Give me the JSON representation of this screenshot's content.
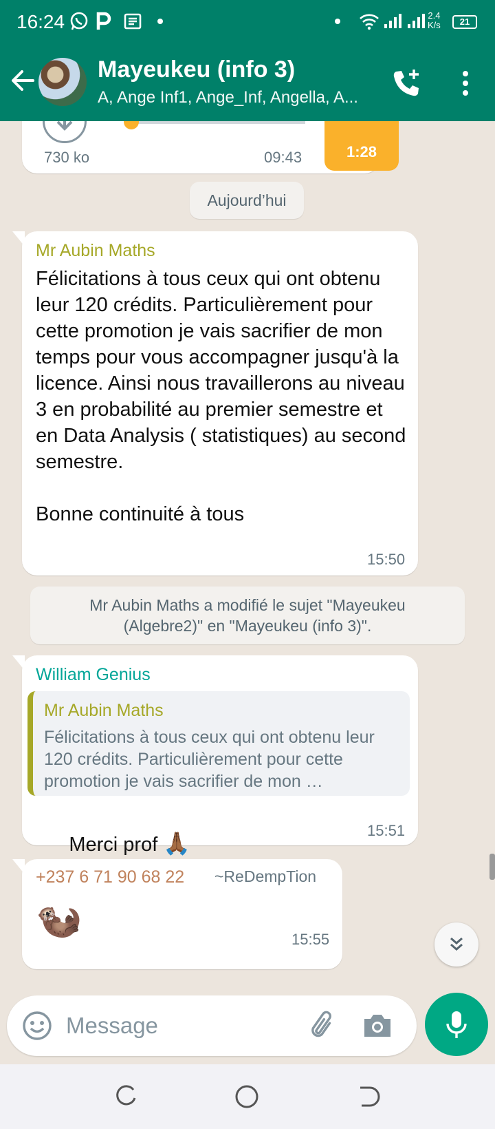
{
  "status_bar": {
    "time": "16:24",
    "speed_value": "2.4",
    "speed_unit": "K/s",
    "battery": "21"
  },
  "header": {
    "title": "Mayeukeu (info 3)",
    "subtitle": "A, Ange Inf1, Ange_Inf, Angella, A..."
  },
  "audio_message": {
    "size": "730 ko",
    "time": "09:43",
    "duration": "1:28",
    "progress": 0.0
  },
  "date_chip": "Aujourd’hui",
  "messages": [
    {
      "sender": "Mr Aubin Maths",
      "sender_color": "#a6a828",
      "text": "Félicitations à tous ceux qui ont obtenu leur 120 crédits. Particulièrement pour cette promotion je vais sacrifier de mon temps pour vous accompagner jusqu'à la licence. Ainsi nous travaillerons au niveau 3 en probabilité au premier semestre et en Data Analysis ( statistiques) au second semestre.\n\nBonne continuité à tous",
      "time": "15:50"
    },
    {
      "sender": "William Genius",
      "sender_color": "#02a698",
      "quote_sender": "Mr Aubin Maths",
      "quote_text": "Félicitations à tous ceux qui ont obtenu leur 120 crédits. Particulièrement pour cette promotion je vais sacrifier de mon …",
      "text": "Merci prof ",
      "emoji": "🙏🏾",
      "time": "15:51"
    },
    {
      "sender": "+237 6 71 90 68 22",
      "sender_color": "#c0825c",
      "push_name": "~ReDempTion",
      "emoji": "🦦",
      "time": "15:55"
    }
  ],
  "system_message": "Mr Aubin Maths a modifié le sujet \"Mayeukeu (Algebre2)\" en \"Mayeukeu (info 3)\".",
  "input": {
    "placeholder": "Message",
    "value": ""
  },
  "colors": {
    "header": "#008069",
    "accent": "#00a884",
    "chat_bg": "#ece5dd"
  },
  "icons": [
    "whatsapp-icon",
    "parking-icon",
    "news-icon",
    "wifi-icon",
    "signal-icon",
    "battery-icon",
    "back-arrow-icon",
    "add-call-icon",
    "more-vert-icon",
    "download-icon",
    "double-chevron-down-icon",
    "emoji-icon",
    "attach-icon",
    "camera-icon",
    "mic-icon",
    "recents-icon",
    "home-icon",
    "back-icon"
  ]
}
